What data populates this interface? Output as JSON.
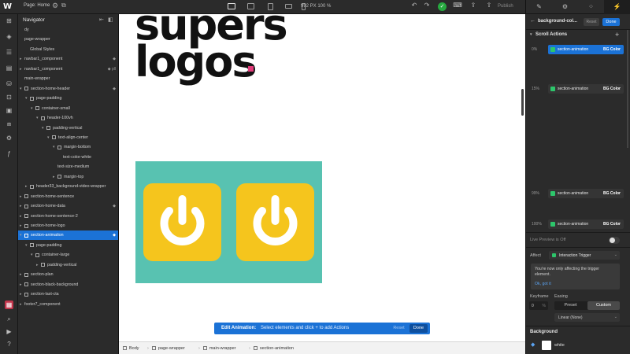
{
  "topbar": {
    "logo": "W",
    "page_label": "Page: Home",
    "gear_icon": "gear-icon",
    "size_readout": "992 PX  100 %",
    "publish_label": "Publish"
  },
  "navigator": {
    "title": "Navigator",
    "rows": [
      {
        "text": "dy",
        "indent": 0,
        "caret": "",
        "box": false,
        "right": "",
        "selected": false
      },
      {
        "text": "page-wrapper",
        "indent": 0,
        "caret": "",
        "box": false,
        "right": "",
        "selected": false
      },
      {
        "text": "Global Styles",
        "indent": 1,
        "caret": "",
        "box": false,
        "right": "",
        "selected": false
      },
      {
        "text": "navbar1_component",
        "indent": 0,
        "caret": "▸",
        "box": false,
        "right": "◆",
        "selected": false
      },
      {
        "text": "navbar1_component",
        "indent": 0,
        "caret": "▸",
        "box": false,
        "right": "◆ pll",
        "selected": false
      },
      {
        "text": "main-wrapper",
        "indent": 0,
        "caret": "",
        "box": false,
        "right": "",
        "selected": false
      },
      {
        "text": "section-home-header",
        "indent": 0,
        "caret": "▾",
        "box": true,
        "right": "◆",
        "selected": false
      },
      {
        "text": "page-padding",
        "indent": 1,
        "caret": "▾",
        "box": true,
        "right": "",
        "selected": false
      },
      {
        "text": "container-small",
        "indent": 2,
        "caret": "▾",
        "box": true,
        "right": "",
        "selected": false
      },
      {
        "text": "header-100vh",
        "indent": 3,
        "caret": "▾",
        "box": true,
        "right": "",
        "selected": false
      },
      {
        "text": "padding-vertical",
        "indent": 4,
        "caret": "▾",
        "box": true,
        "right": "",
        "selected": false
      },
      {
        "text": "text-align-center",
        "indent": 5,
        "caret": "▾",
        "box": true,
        "right": "",
        "selected": false
      },
      {
        "text": "margin-bottom",
        "indent": 6,
        "caret": "▾",
        "box": true,
        "right": "",
        "selected": false
      },
      {
        "text": "text-color-white",
        "indent": 7,
        "caret": "",
        "box": false,
        "right": "",
        "selected": false
      },
      {
        "text": "text-size-medium",
        "indent": 6,
        "caret": "",
        "box": false,
        "right": "",
        "selected": false
      },
      {
        "text": "margin-top",
        "indent": 6,
        "caret": "▸",
        "box": true,
        "right": "",
        "selected": false
      },
      {
        "text": "header33_background-video-wrapper",
        "indent": 1,
        "caret": "▸",
        "box": true,
        "right": "",
        "selected": false
      },
      {
        "text": "section-home-sentence",
        "indent": 0,
        "caret": "▸",
        "box": true,
        "right": "",
        "selected": false
      },
      {
        "text": "section-home-data",
        "indent": 0,
        "caret": "▸",
        "box": true,
        "right": "◆",
        "selected": false
      },
      {
        "text": "section-home-sentence-2",
        "indent": 0,
        "caret": "▸",
        "box": true,
        "right": "",
        "selected": false
      },
      {
        "text": "section-home-logo",
        "indent": 0,
        "caret": "▸",
        "box": true,
        "right": "",
        "selected": false
      },
      {
        "text": "section-animation",
        "indent": 0,
        "caret": "▾",
        "box": true,
        "right": "◆",
        "selected": true
      },
      {
        "text": "page-padding",
        "indent": 1,
        "caret": "▾",
        "box": true,
        "right": "",
        "selected": false
      },
      {
        "text": "container-large",
        "indent": 2,
        "caret": "▾",
        "box": true,
        "right": "",
        "selected": false
      },
      {
        "text": "padding-vertical",
        "indent": 3,
        "caret": "▸",
        "box": true,
        "right": "",
        "selected": false
      },
      {
        "text": "section-plan",
        "indent": 0,
        "caret": "▸",
        "box": true,
        "right": "",
        "selected": false
      },
      {
        "text": "section-black-background",
        "indent": 0,
        "caret": "▸",
        "box": true,
        "right": "",
        "selected": false
      },
      {
        "text": "section-last-cta",
        "indent": 0,
        "caret": "▸",
        "box": true,
        "right": "",
        "selected": false
      },
      {
        "text": "footer7_component",
        "indent": 0,
        "caret": "▸",
        "box": false,
        "right": "",
        "selected": false
      }
    ]
  },
  "canvas": {
    "hero_line1": "supers",
    "hero_line2": "logos",
    "hero_dot_color": "#e23b7a",
    "teal_color": "#58c2b1",
    "tile_color": "#f5c51d",
    "tile_icons": [
      "power-icon",
      "power-icon"
    ]
  },
  "toast": {
    "title": "Edit Animation:",
    "message": "Select elements and click + to add Actions",
    "reset_label": "Reset",
    "done_label": "Done"
  },
  "breadcrumbs": [
    "Body",
    "page-wrapper",
    "main-wrapper",
    "section-animation"
  ],
  "right_panel": {
    "header_name": "background-col...",
    "reset_label": "Reset",
    "done_label": "Done",
    "section_title": "Scroll Actions",
    "keyframes": [
      {
        "pct": "0%",
        "label": "section-animation",
        "tag": "BG Color",
        "selected": true
      },
      {
        "pct": "15%",
        "label": "section-animation",
        "tag": "BG Color",
        "selected": false
      },
      {
        "pct": "99%",
        "label": "section-animation",
        "tag": "BG Color",
        "selected": false
      },
      {
        "pct": "100%",
        "label": "section-animation",
        "tag": "BG Color",
        "selected": false
      }
    ],
    "live_preview": "Live Preview is Off",
    "affect_label": "Affect",
    "affect_value": "Interaction Trigger",
    "info_text": "You're now only affecting the trigger element.",
    "info_link": "Ok, got it",
    "keyframe_label": "Keyframe",
    "easing_label": "Easing",
    "keyframe_value": "0",
    "keyframe_unit": "%",
    "preset_label": "Preset",
    "custom_label": "Custom",
    "easing_value": "Linear (None)",
    "background_title": "Background",
    "background_value": "white",
    "accent_color": "#1b72d6"
  }
}
